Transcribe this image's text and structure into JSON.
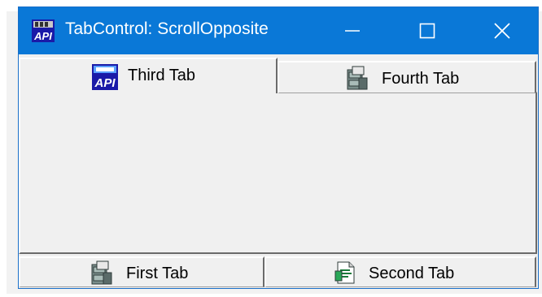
{
  "window": {
    "title": "TabControl: ScrollOpposite",
    "app_icon": "api-logo-icon",
    "controls": [
      "minimize-icon",
      "maximize-icon",
      "close-icon"
    ]
  },
  "tabs": {
    "top_row": [
      {
        "label": "Third Tab",
        "icon": "api-logo-icon",
        "selected": true
      },
      {
        "label": "Fourth Tab",
        "icon": "cabinet-icon",
        "selected": false
      }
    ],
    "bottom_row": [
      {
        "label": "First Tab",
        "icon": "cabinet-icon",
        "selected": false
      },
      {
        "label": "Second Tab",
        "icon": "document-icon",
        "selected": false
      }
    ]
  },
  "colors": {
    "titlebar": "#0a78d7",
    "face": "#f0f0f0"
  }
}
